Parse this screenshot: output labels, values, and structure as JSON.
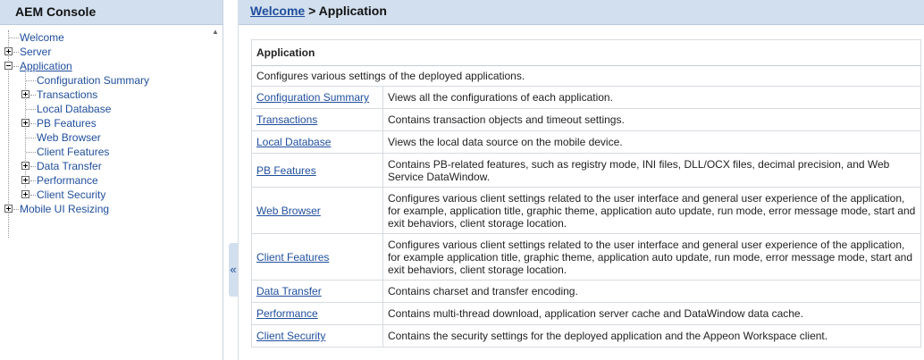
{
  "left_panel": {
    "title": "AEM Console",
    "tree": [
      {
        "label": "Welcome",
        "level": 0,
        "expander": "none"
      },
      {
        "label": "Server",
        "level": 0,
        "expander": "plus"
      },
      {
        "label": "Application",
        "level": 0,
        "expander": "minus",
        "selected": true
      },
      {
        "label": "Configuration Summary",
        "level": 1,
        "expander": "none"
      },
      {
        "label": "Transactions",
        "level": 1,
        "expander": "plus"
      },
      {
        "label": "Local Database",
        "level": 1,
        "expander": "none"
      },
      {
        "label": "PB Features",
        "level": 1,
        "expander": "plus"
      },
      {
        "label": "Web Browser",
        "level": 1,
        "expander": "none"
      },
      {
        "label": "Client Features",
        "level": 1,
        "expander": "none"
      },
      {
        "label": "Data Transfer",
        "level": 1,
        "expander": "plus"
      },
      {
        "label": "Performance",
        "level": 1,
        "expander": "plus"
      },
      {
        "label": "Client Security",
        "level": 1,
        "expander": "plus"
      },
      {
        "label": "Mobile UI Resizing",
        "level": 0,
        "expander": "plus"
      }
    ],
    "scroll_up_icon": "▲"
  },
  "collapse_icon": "«",
  "breadcrumb": {
    "link": "Welcome",
    "separator": " > ",
    "current": "Application"
  },
  "table": {
    "title": "Application",
    "description": "Configures various settings of the deployed applications.",
    "rows": [
      {
        "name": "Configuration Summary",
        "desc": "Views all the configurations of each application."
      },
      {
        "name": "Transactions",
        "desc": "Contains transaction objects and timeout settings."
      },
      {
        "name": "Local Database",
        "desc": "Views the local data source on the mobile device."
      },
      {
        "name": "PB Features",
        "desc": "Contains PB-related features, such as registry mode, INI files, DLL/OCX files, decimal precision, and Web Service DataWindow."
      },
      {
        "name": "Web Browser",
        "desc": "Configures various client settings related to the user interface and general user experience of the application, for example, application title, graphic theme, application auto update, run mode, error message mode, start and exit behaviors, client storage location."
      },
      {
        "name": "Client Features",
        "desc": "Configures various client settings related to the user interface and general user experience of the application, for example application title, graphic theme, application auto update, run mode, error message mode, start and exit behaviors, client storage location."
      },
      {
        "name": "Data Transfer",
        "desc": "Contains charset and transfer encoding."
      },
      {
        "name": "Performance",
        "desc": "Contains multi-thread download, application server cache and DataWindow data cache."
      },
      {
        "name": "Client Security",
        "desc": "Contains the security settings for the deployed application and the Appeon Workspace client."
      }
    ]
  }
}
